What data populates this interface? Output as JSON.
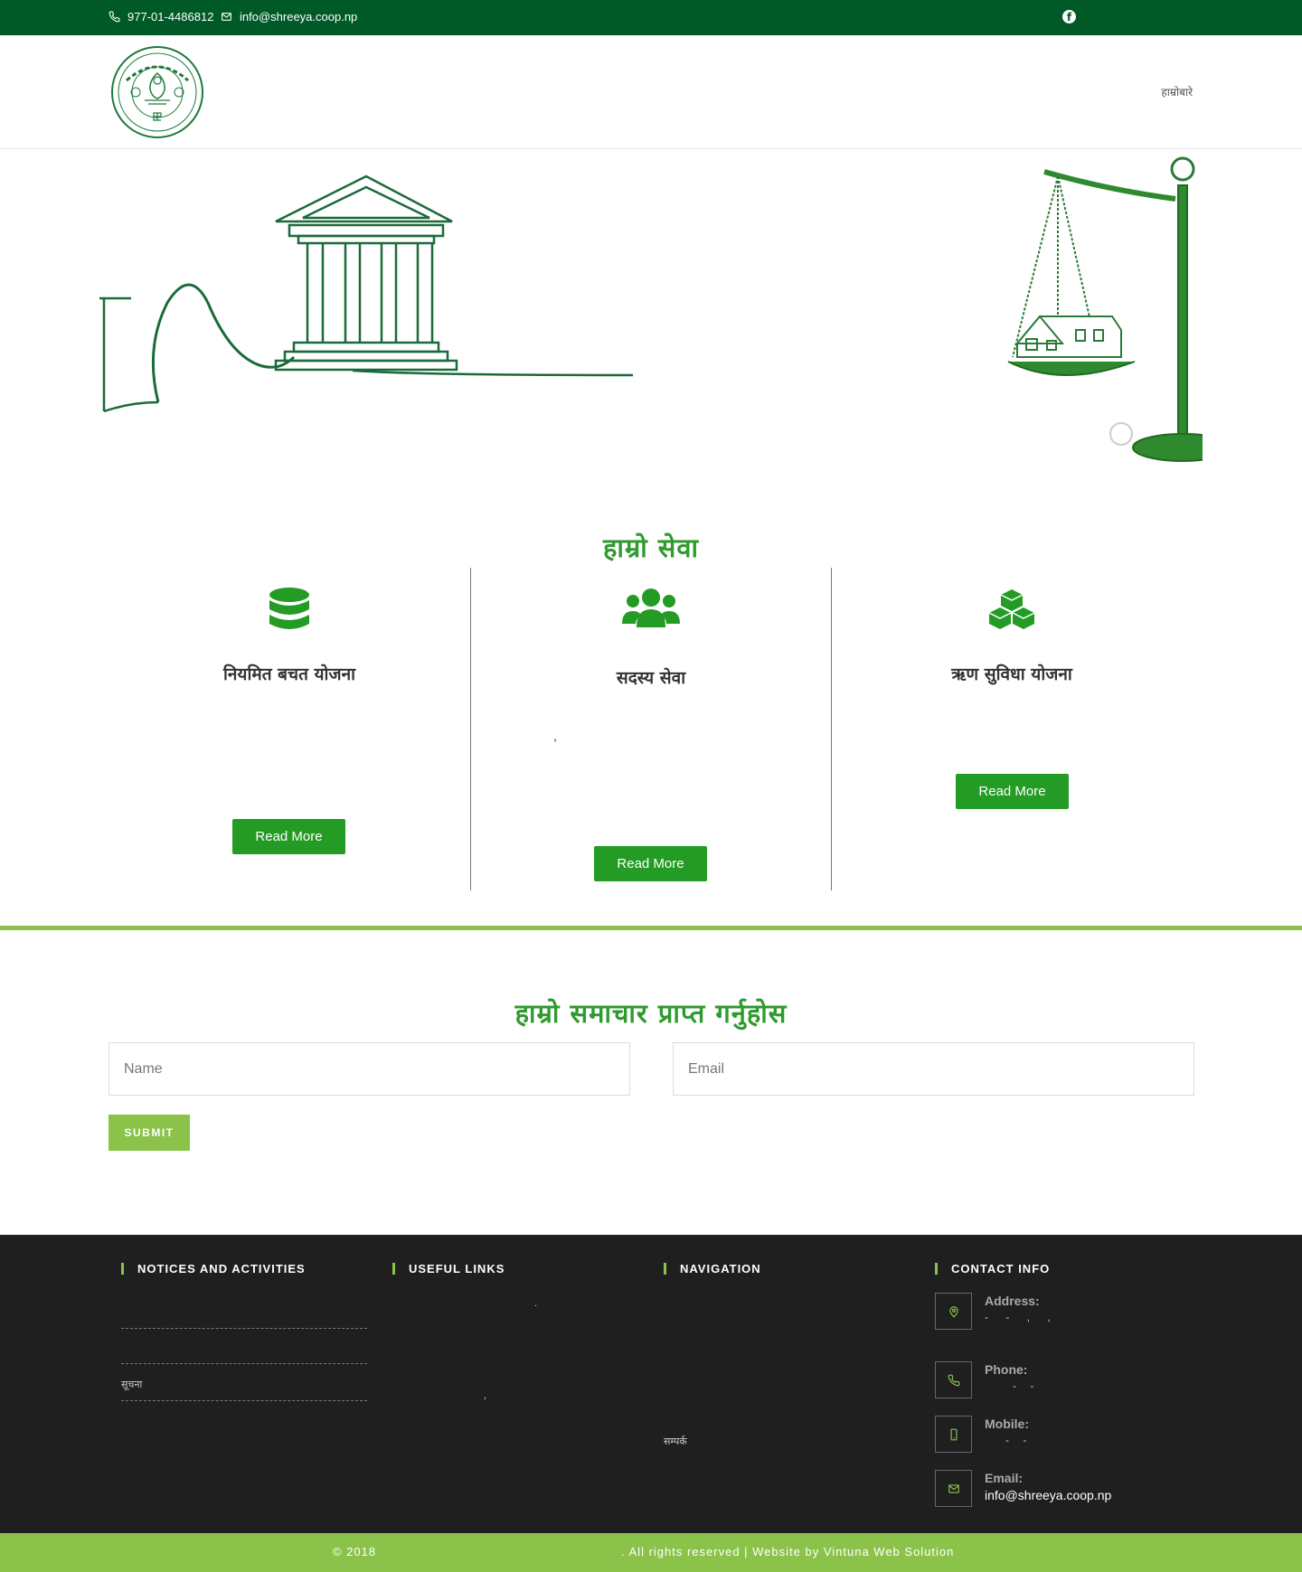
{
  "topbar": {
    "phone": "977-01-4486812",
    "email": "info@shreeya.coop.np"
  },
  "header": {
    "nav_item": "हाम्रोबारे"
  },
  "services": {
    "title": "हाम्रो सेवा",
    "cards": [
      {
        "title": "नियमित बचत योजना",
        "button": "Read More"
      },
      {
        "title": "सदस्य सेवा",
        "note": ",",
        "button": "Read More"
      },
      {
        "title": "ऋण सुविधा योजना",
        "button": "Read More"
      }
    ]
  },
  "newsletter": {
    "title": "हाम्रो समाचार प्राप्त गर्नुहोस",
    "name_placeholder": "Name",
    "email_placeholder": "Email",
    "submit": "SUBMIT"
  },
  "footer": {
    "col1_title": "NOTICES AND ACTIVITIES",
    "col1_item": "सूचना",
    "col2_title": "USEFUL LINKS",
    "col2_mark_1": ".",
    "col2_mark_2": ",",
    "col3_title": "NAVIGATION",
    "col3_item": "सम्पर्क",
    "col4_title": "CONTACT INFO",
    "address_label": "Address:",
    "address_value": "-  - ,  ,",
    "phone_label": "Phone:",
    "phone_value": "- -",
    "mobile_label": "Mobile:",
    "mobile_value": "- -",
    "email_label": "Email:",
    "email_value": "info@shreeya.coop.np"
  },
  "copyright": {
    "left": "© 2018",
    "right": ". All rights reserved | Website by Vintuna Web Solution"
  },
  "colors": {
    "topbar": "#005a28",
    "accent": "#8bc34a",
    "button": "#239b24",
    "footer": "#1f1f1f"
  }
}
